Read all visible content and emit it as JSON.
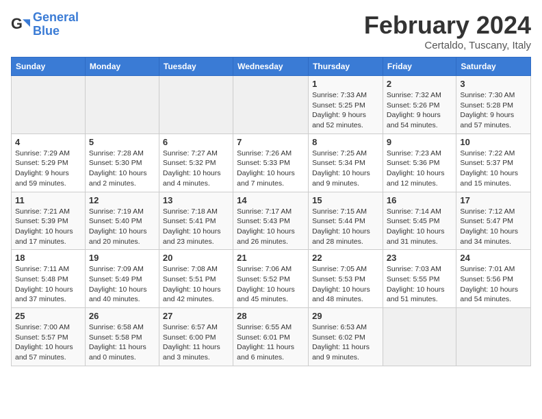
{
  "header": {
    "logo_general": "General",
    "logo_blue": "Blue",
    "month_title": "February 2024",
    "subtitle": "Certaldo, Tuscany, Italy"
  },
  "days_of_week": [
    "Sunday",
    "Monday",
    "Tuesday",
    "Wednesday",
    "Thursday",
    "Friday",
    "Saturday"
  ],
  "weeks": [
    [
      {
        "day": "",
        "info": ""
      },
      {
        "day": "",
        "info": ""
      },
      {
        "day": "",
        "info": ""
      },
      {
        "day": "",
        "info": ""
      },
      {
        "day": "1",
        "info": "Sunrise: 7:33 AM\nSunset: 5:25 PM\nDaylight: 9 hours\nand 52 minutes."
      },
      {
        "day": "2",
        "info": "Sunrise: 7:32 AM\nSunset: 5:26 PM\nDaylight: 9 hours\nand 54 minutes."
      },
      {
        "day": "3",
        "info": "Sunrise: 7:30 AM\nSunset: 5:28 PM\nDaylight: 9 hours\nand 57 minutes."
      }
    ],
    [
      {
        "day": "4",
        "info": "Sunrise: 7:29 AM\nSunset: 5:29 PM\nDaylight: 9 hours\nand 59 minutes."
      },
      {
        "day": "5",
        "info": "Sunrise: 7:28 AM\nSunset: 5:30 PM\nDaylight: 10 hours\nand 2 minutes."
      },
      {
        "day": "6",
        "info": "Sunrise: 7:27 AM\nSunset: 5:32 PM\nDaylight: 10 hours\nand 4 minutes."
      },
      {
        "day": "7",
        "info": "Sunrise: 7:26 AM\nSunset: 5:33 PM\nDaylight: 10 hours\nand 7 minutes."
      },
      {
        "day": "8",
        "info": "Sunrise: 7:25 AM\nSunset: 5:34 PM\nDaylight: 10 hours\nand 9 minutes."
      },
      {
        "day": "9",
        "info": "Sunrise: 7:23 AM\nSunset: 5:36 PM\nDaylight: 10 hours\nand 12 minutes."
      },
      {
        "day": "10",
        "info": "Sunrise: 7:22 AM\nSunset: 5:37 PM\nDaylight: 10 hours\nand 15 minutes."
      }
    ],
    [
      {
        "day": "11",
        "info": "Sunrise: 7:21 AM\nSunset: 5:39 PM\nDaylight: 10 hours\nand 17 minutes."
      },
      {
        "day": "12",
        "info": "Sunrise: 7:19 AM\nSunset: 5:40 PM\nDaylight: 10 hours\nand 20 minutes."
      },
      {
        "day": "13",
        "info": "Sunrise: 7:18 AM\nSunset: 5:41 PM\nDaylight: 10 hours\nand 23 minutes."
      },
      {
        "day": "14",
        "info": "Sunrise: 7:17 AM\nSunset: 5:43 PM\nDaylight: 10 hours\nand 26 minutes."
      },
      {
        "day": "15",
        "info": "Sunrise: 7:15 AM\nSunset: 5:44 PM\nDaylight: 10 hours\nand 28 minutes."
      },
      {
        "day": "16",
        "info": "Sunrise: 7:14 AM\nSunset: 5:45 PM\nDaylight: 10 hours\nand 31 minutes."
      },
      {
        "day": "17",
        "info": "Sunrise: 7:12 AM\nSunset: 5:47 PM\nDaylight: 10 hours\nand 34 minutes."
      }
    ],
    [
      {
        "day": "18",
        "info": "Sunrise: 7:11 AM\nSunset: 5:48 PM\nDaylight: 10 hours\nand 37 minutes."
      },
      {
        "day": "19",
        "info": "Sunrise: 7:09 AM\nSunset: 5:49 PM\nDaylight: 10 hours\nand 40 minutes."
      },
      {
        "day": "20",
        "info": "Sunrise: 7:08 AM\nSunset: 5:51 PM\nDaylight: 10 hours\nand 42 minutes."
      },
      {
        "day": "21",
        "info": "Sunrise: 7:06 AM\nSunset: 5:52 PM\nDaylight: 10 hours\nand 45 minutes."
      },
      {
        "day": "22",
        "info": "Sunrise: 7:05 AM\nSunset: 5:53 PM\nDaylight: 10 hours\nand 48 minutes."
      },
      {
        "day": "23",
        "info": "Sunrise: 7:03 AM\nSunset: 5:55 PM\nDaylight: 10 hours\nand 51 minutes."
      },
      {
        "day": "24",
        "info": "Sunrise: 7:01 AM\nSunset: 5:56 PM\nDaylight: 10 hours\nand 54 minutes."
      }
    ],
    [
      {
        "day": "25",
        "info": "Sunrise: 7:00 AM\nSunset: 5:57 PM\nDaylight: 10 hours\nand 57 minutes."
      },
      {
        "day": "26",
        "info": "Sunrise: 6:58 AM\nSunset: 5:58 PM\nDaylight: 11 hours\nand 0 minutes."
      },
      {
        "day": "27",
        "info": "Sunrise: 6:57 AM\nSunset: 6:00 PM\nDaylight: 11 hours\nand 3 minutes."
      },
      {
        "day": "28",
        "info": "Sunrise: 6:55 AM\nSunset: 6:01 PM\nDaylight: 11 hours\nand 6 minutes."
      },
      {
        "day": "29",
        "info": "Sunrise: 6:53 AM\nSunset: 6:02 PM\nDaylight: 11 hours\nand 9 minutes."
      },
      {
        "day": "",
        "info": ""
      },
      {
        "day": "",
        "info": ""
      }
    ]
  ]
}
